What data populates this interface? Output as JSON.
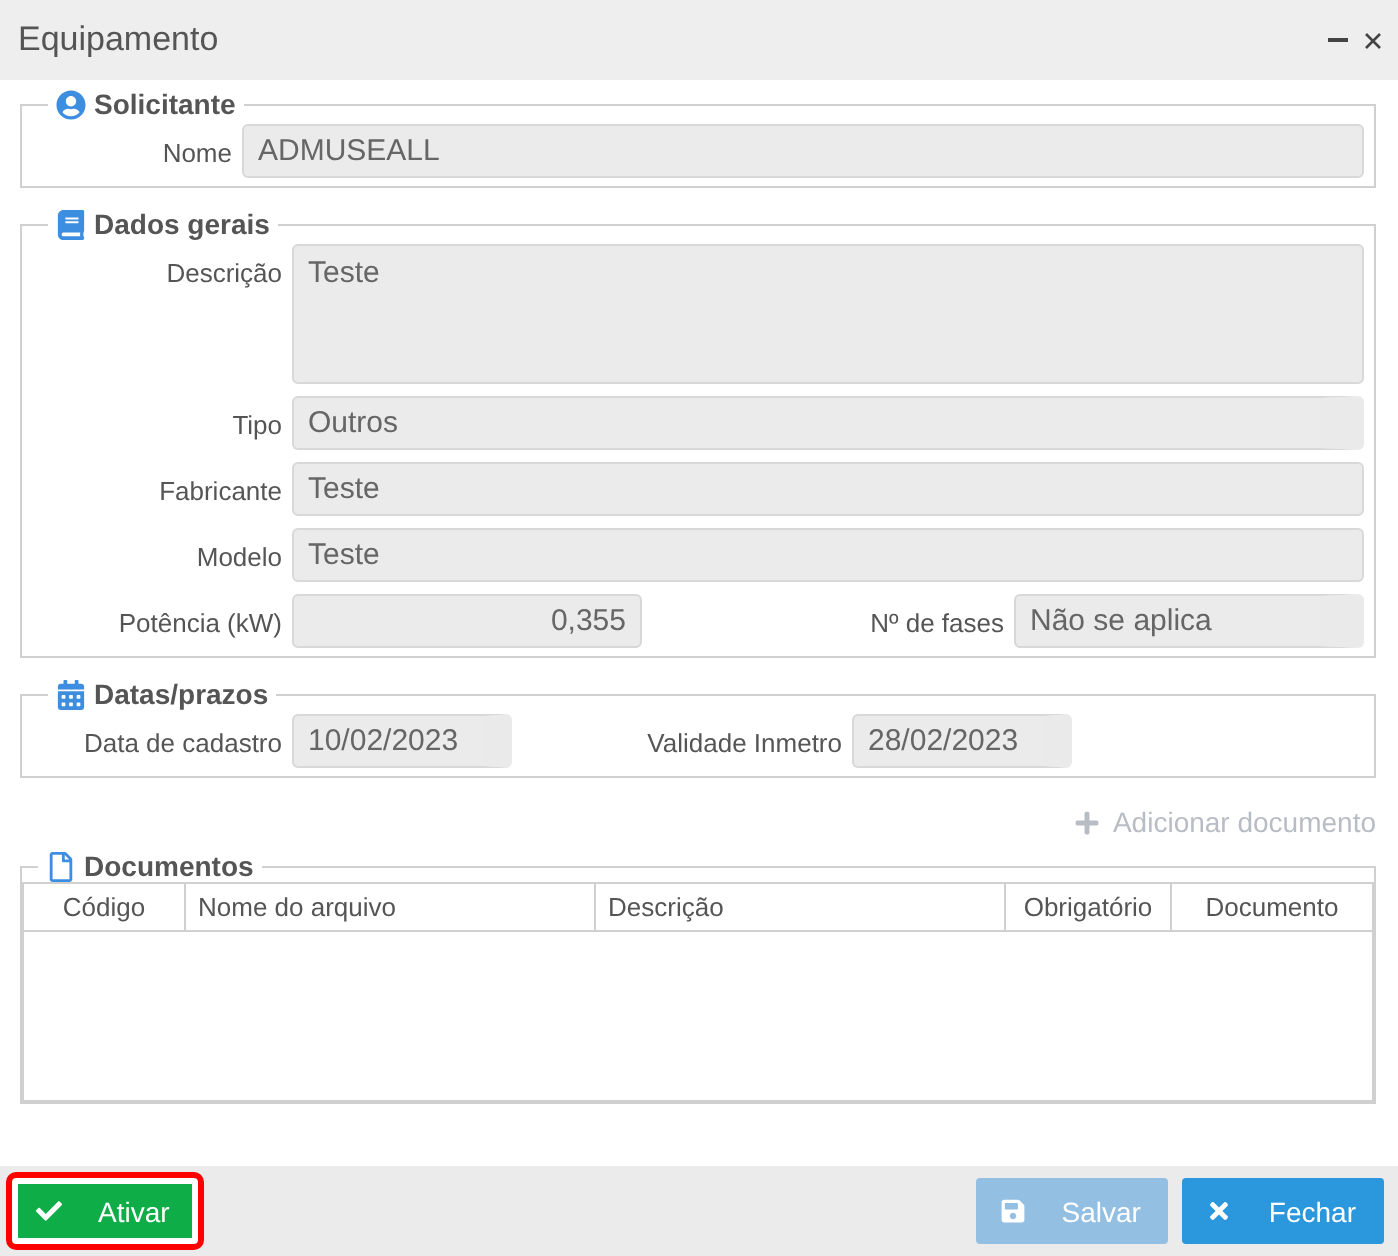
{
  "window": {
    "title": "Equipamento"
  },
  "sections": [
    {
      "kind": "requester",
      "title": "Solicitante",
      "rows": [
        [
          {
            "label": "Nome",
            "value": "ADMUSEALL",
            "kind": "text"
          }
        ]
      ]
    },
    {
      "kind": "general",
      "title": "Dados gerais",
      "rows": [
        [
          {
            "label": "Descrição",
            "value": "Teste",
            "kind": "textarea"
          }
        ],
        [
          {
            "label": "Tipo",
            "value": "Outros",
            "kind": "select"
          }
        ],
        [
          {
            "label": "Fabricante",
            "value": "Teste",
            "kind": "text"
          }
        ],
        [
          {
            "label": "Modelo",
            "value": "Teste",
            "kind": "text"
          }
        ],
        [
          {
            "label": "Potência (kW)",
            "value": "0,355",
            "kind": "number"
          },
          {
            "label": "Nº de fases",
            "value": "Não se aplica",
            "kind": "select"
          }
        ]
      ]
    },
    {
      "kind": "dates",
      "title": "Datas/prazos",
      "rows": [
        [
          {
            "label": "Data de cadastro",
            "value": "10/02/2023",
            "kind": "date"
          },
          {
            "label": "Validade Inmetro",
            "value": "28/02/2023",
            "kind": "date"
          }
        ]
      ]
    }
  ],
  "add_document": {
    "label": "Adicionar documento",
    "disabled": true
  },
  "documents": {
    "title": "Documentos",
    "columns": [
      "Código",
      "Nome do arquivo",
      "Descrição",
      "Obrigatório",
      "Documento"
    ]
  },
  "footer": {
    "buttons": [
      {
        "kind": "activate",
        "label": "Ativar",
        "disabled": false,
        "highlighted": true
      },
      {
        "kind": "save",
        "label": "Salvar",
        "disabled": true,
        "highlighted": false
      },
      {
        "kind": "close",
        "label": "Fechar",
        "disabled": false,
        "highlighted": false
      }
    ]
  }
}
